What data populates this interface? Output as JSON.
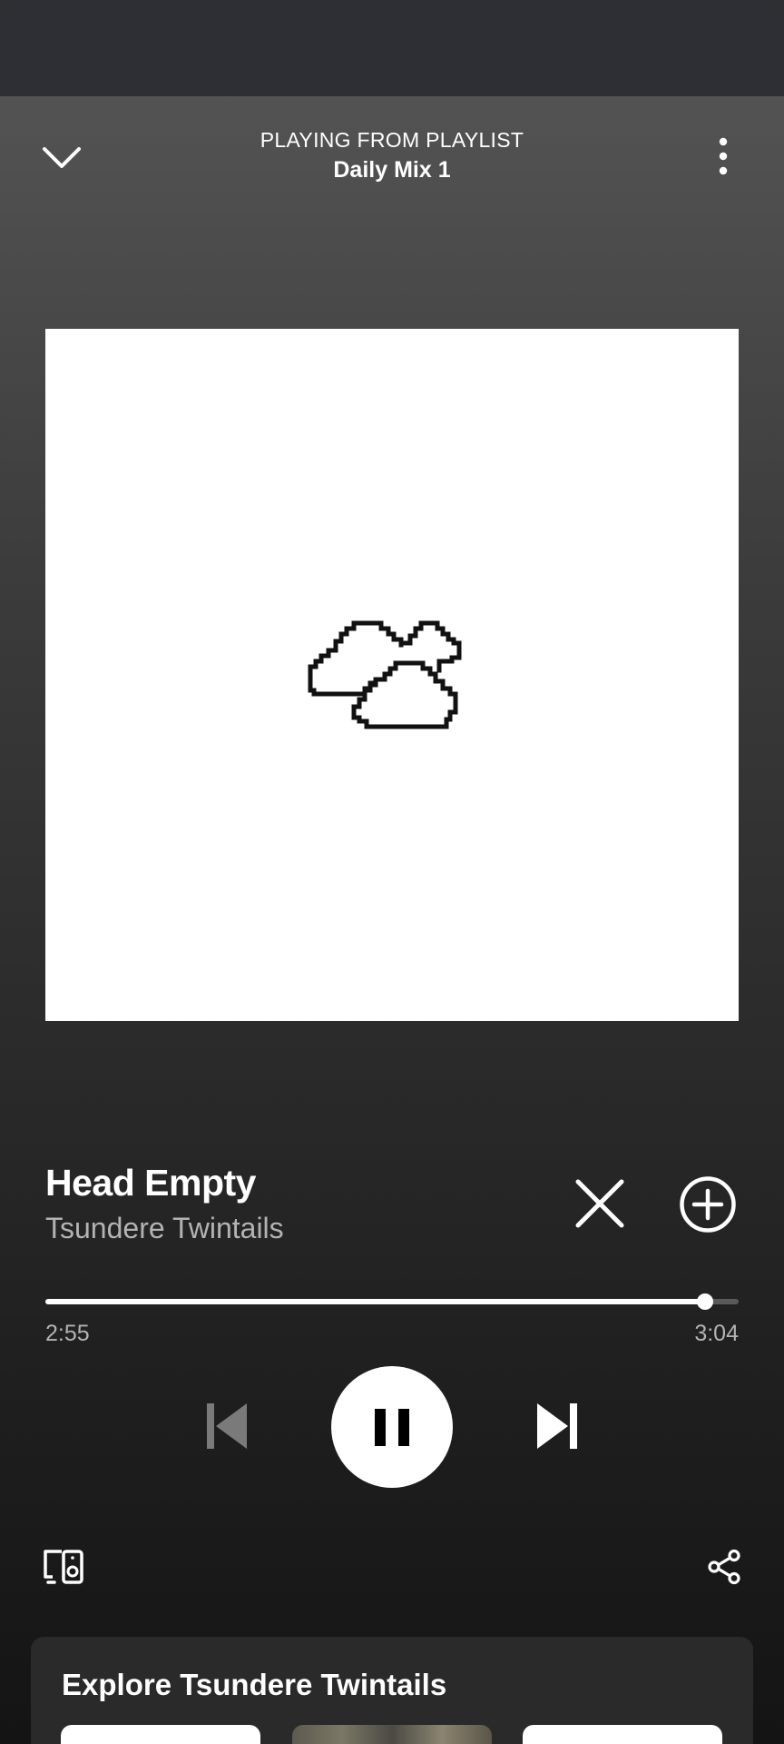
{
  "header": {
    "context_label": "PLAYING FROM PLAYLIST",
    "context_name": "Daily Mix 1"
  },
  "cover": {
    "icon": "clouds-pixel-art"
  },
  "track": {
    "title": "Head Empty",
    "artist": "Tsundere Twintails"
  },
  "progress": {
    "elapsed": "2:55",
    "duration": "3:04",
    "fraction": 0.951
  },
  "controls": {
    "remove_icon": "x-icon",
    "add_icon": "plus-circle-icon",
    "previous_icon": "skip-previous-icon",
    "pause_icon": "pause-icon",
    "next_icon": "skip-next-icon",
    "devices_icon": "connect-devices-icon",
    "share_icon": "share-icon"
  },
  "explore": {
    "title": "Explore Tsundere Twintails"
  },
  "colors": {
    "accent": "#ffffff",
    "muted_text": "#b3b3b3",
    "background_top": "#535353",
    "background_bottom": "#141414"
  }
}
